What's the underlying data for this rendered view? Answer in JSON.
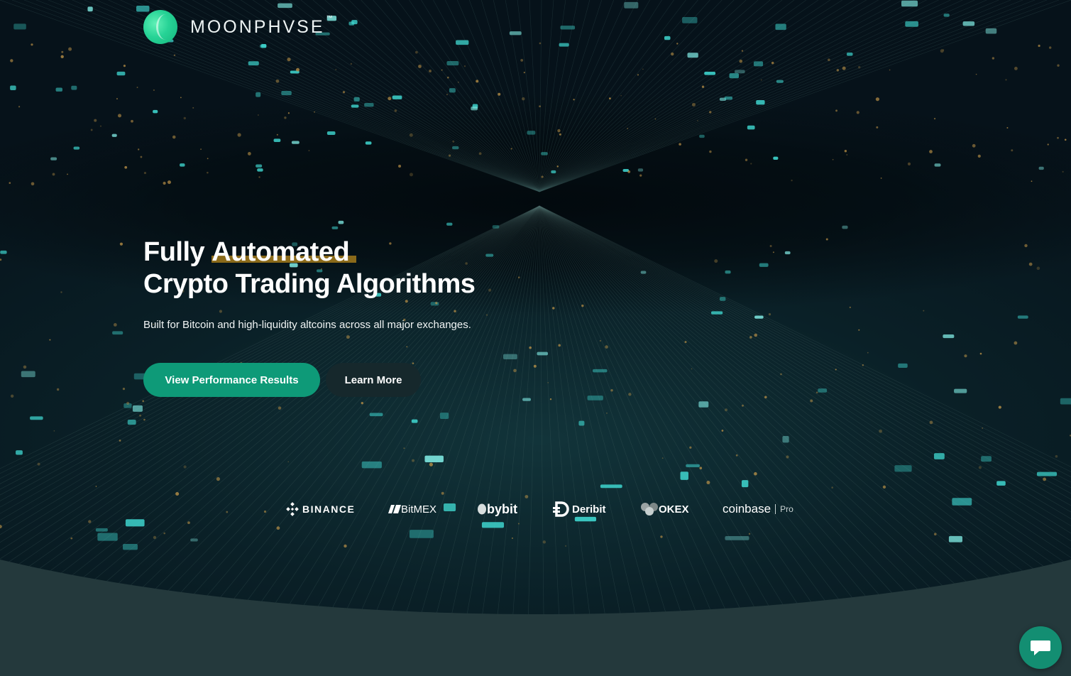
{
  "brand": {
    "name": "MOONPHVSE",
    "trademark": "™",
    "accent_color": "#27d396"
  },
  "hero": {
    "headline_line1_a": "Fully ",
    "headline_line1_b": "Automated",
    "headline_line2": "Crypto Trading Algorithms",
    "subheadline": "Built for Bitcoin and high-liquidity altcoins across all major exchanges.",
    "primary_cta": "View Performance Results",
    "secondary_cta": "Learn More",
    "primary_color": "#0e9a78",
    "highlight_color": "#8a6a1a"
  },
  "exchanges": {
    "binance": "BINANCE",
    "bitmex": "BitMEX",
    "bybit": "bybit",
    "deribit": "Deribit",
    "okex": "OKEX",
    "coinbase": "coinbase",
    "coinbase_suffix": "Pro"
  },
  "icons": {
    "logo": "moon-logo-icon",
    "chat": "chat-bubble-icon"
  }
}
